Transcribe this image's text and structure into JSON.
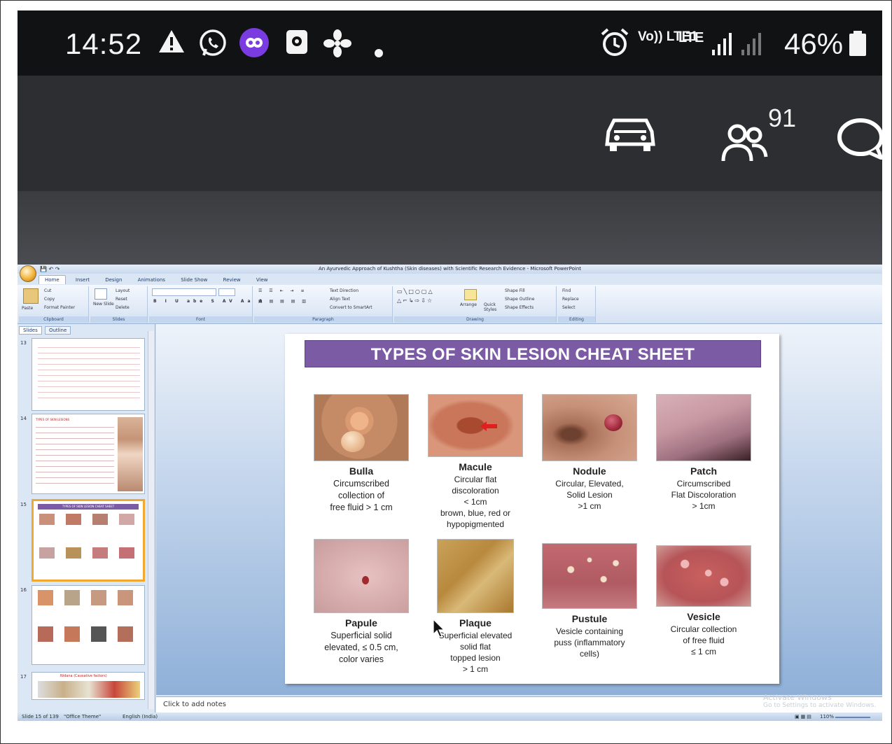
{
  "status_bar": {
    "time": "14:52",
    "network": "Vo)) LTE1",
    "network_type": "LTE",
    "battery": "46%",
    "icons": [
      "warning-icon",
      "whatsapp-icon",
      "link-app-icon",
      "screen-record-icon",
      "fan-icon",
      "dot-icon",
      "alarm-icon",
      "signal-icon",
      "battery-icon"
    ]
  },
  "app_toolbar": {
    "viewer_count": "91",
    "icons": [
      "car-icon",
      "viewers-icon",
      "chat-icon"
    ]
  },
  "powerpoint": {
    "window_title": "An Ayurvedic Approach of Kushtha (Skin diseases) with Scientific Research Evidence - Microsoft PowerPoint",
    "tabs": [
      "Home",
      "Insert",
      "Design",
      "Animations",
      "Slide Show",
      "Review",
      "View"
    ],
    "ribbon": {
      "clipboard": {
        "label": "Clipboard",
        "paste": "Paste",
        "cut": "Cut",
        "copy": "Copy",
        "format_painter": "Format Painter"
      },
      "slides": {
        "label": "Slides",
        "new_slide": "New Slide",
        "layout": "Layout",
        "reset": "Reset",
        "delete": "Delete"
      },
      "font": {
        "label": "Font"
      },
      "paragraph": {
        "label": "Paragraph",
        "text_direction": "Text Direction",
        "align_text": "Align Text",
        "convert": "Convert to SmartArt"
      },
      "drawing": {
        "label": "Drawing",
        "arrange": "Arrange",
        "quick_styles": "Quick Styles",
        "shape_fill": "Shape Fill",
        "shape_outline": "Shape Outline",
        "shape_effects": "Shape Effects"
      },
      "editing": {
        "label": "Editing",
        "find": "Find",
        "replace": "Replace",
        "select": "Select"
      }
    },
    "pane_tabs": [
      "Slides",
      "Outline"
    ],
    "thumbnails": [
      {
        "number": "13"
      },
      {
        "number": "14",
        "title": "TYPES OF SKIN LESIONS"
      },
      {
        "number": "15",
        "title": "TYPES OF SKIN LESION CHEAT SHEET"
      },
      {
        "number": "16"
      },
      {
        "number": "17",
        "title": "Nidana (Causative factors)"
      }
    ],
    "slide": {
      "title": "TYPES OF SKIN LESION CHEAT SHEET",
      "lesions": [
        {
          "name": "Bulla",
          "desc": "Circumscribed\ncollection of\nfree fluid > 1 cm"
        },
        {
          "name": "Macule",
          "desc": "Circular flat\ndiscoloration\n< 1cm\nbrown, blue, red or\nhypopigmented"
        },
        {
          "name": "Nodule",
          "desc": "Circular, Elevated,\nSolid Lesion\n>1 cm"
        },
        {
          "name": "Patch",
          "desc": "Circumscribed\nFlat Discoloration\n> 1cm"
        },
        {
          "name": "Papule",
          "desc": "Superficial solid\nelevated, ≤ 0.5 cm,\ncolor varies"
        },
        {
          "name": "Plaque",
          "desc": "Superficial elevated\nsolid flat\ntopped lesion\n> 1 cm"
        },
        {
          "name": "Pustule",
          "desc": "Vesicle containing\npuss (inflammatory\ncells)"
        },
        {
          "name": "Vesicle",
          "desc": "Circular collection\nof free fluid\n≤ 1 cm"
        }
      ]
    },
    "notes_placeholder": "Click to add notes",
    "activate_windows": "Activate Windows",
    "activate_sub": "Go to Settings to activate Windows.",
    "status": {
      "slide_counter": "Slide 15 of 139",
      "theme": "\"Office Theme\"",
      "language": "English (India)",
      "zoom": "110%"
    }
  }
}
